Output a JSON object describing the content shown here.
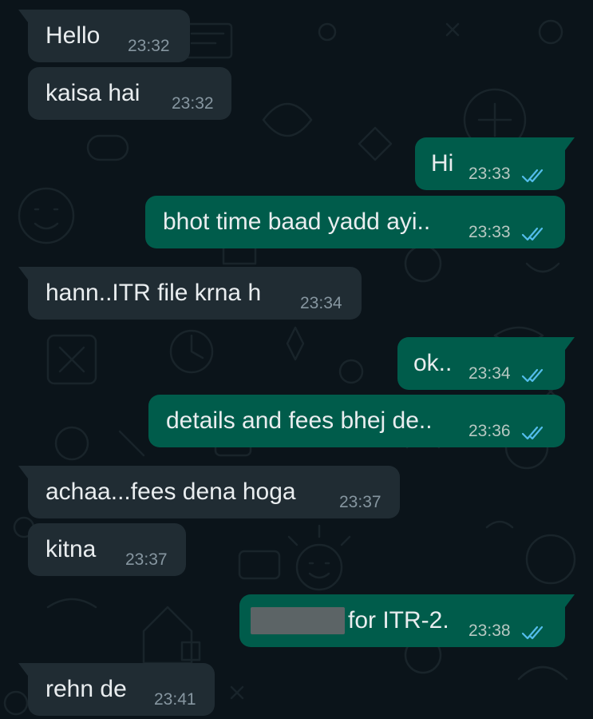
{
  "colors": {
    "background": "#0b141a",
    "incoming_bubble": "#202c33",
    "outgoing_bubble": "#005c4b",
    "read_ticks": "#53bdeb"
  },
  "messages": [
    {
      "direction": "incoming",
      "text": "Hello",
      "time": "23:32"
    },
    {
      "direction": "incoming",
      "text": "kaisa hai",
      "time": "23:32"
    },
    {
      "direction": "outgoing",
      "text": "Hi",
      "time": "23:33",
      "status_icon": "double-check-icon"
    },
    {
      "direction": "outgoing",
      "text": "bhot time baad yadd ayi..",
      "time": "23:33",
      "status_icon": "double-check-icon"
    },
    {
      "direction": "incoming",
      "text": "hann..ITR file krna h",
      "time": "23:34"
    },
    {
      "direction": "outgoing",
      "text": "ok..",
      "time": "23:34",
      "status_icon": "double-check-icon"
    },
    {
      "direction": "outgoing",
      "text": "details and fees bhej de..",
      "time": "23:36",
      "status_icon": "double-check-icon"
    },
    {
      "direction": "incoming",
      "text": "achaa...fees dena hoga",
      "time": "23:37"
    },
    {
      "direction": "incoming",
      "text": "kitna",
      "time": "23:37"
    },
    {
      "direction": "outgoing",
      "text": "for ITR-2.",
      "time": "23:38",
      "status_icon": "double-check-icon",
      "redacted_prefix": true
    },
    {
      "direction": "incoming",
      "text": "rehn de",
      "time": "23:41"
    }
  ]
}
